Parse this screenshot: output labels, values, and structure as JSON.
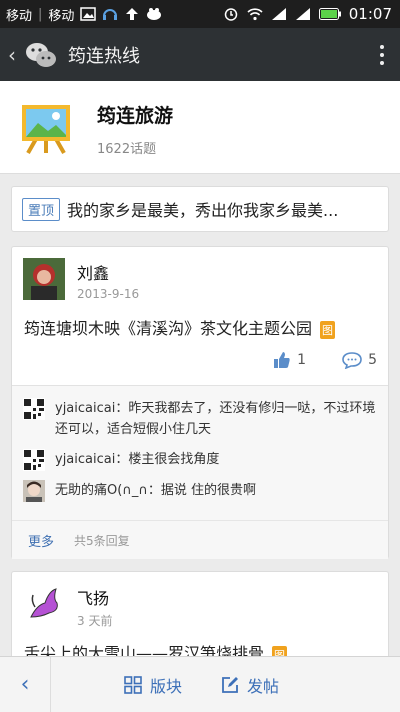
{
  "status": {
    "carrier1": "移动",
    "carrier2": "移动",
    "time": "01:07"
  },
  "nav": {
    "title": "筠连热线"
  },
  "header": {
    "title": "筠连旅游",
    "subtitle": "1622话题"
  },
  "pinned": {
    "tag": "置顶",
    "text": "我的家乡是最美，秀出你我家乡最美..."
  },
  "post1": {
    "author": "刘鑫",
    "date": "2013-9-16",
    "title": "筠连塘坝木映《清溪沟》茶文化主题公园",
    "badge": "图",
    "likes": "1",
    "comments": "5",
    "replies": [
      {
        "text": "yjaicaicai：昨天我都去了，还没有修归一哒，不过环境还可以，适合短假小住几天"
      },
      {
        "text": "yjaicaicai：楼主很会找角度"
      },
      {
        "text": "无助的痛O(∩_∩：据说 住的很贵啊"
      }
    ],
    "more": "更多",
    "reply_count": "共5条回复"
  },
  "post2": {
    "author": "飞扬",
    "date": "3 天前",
    "title": "舌尖上的大雪山——罗汉笋烧排骨",
    "badge": "图"
  },
  "tabbar": {
    "block_label": "版块",
    "post_label": "发帖"
  },
  "colors": {
    "accent": "#3d70b8",
    "navbar": "#2d3134",
    "badge": "#f0a21e"
  }
}
